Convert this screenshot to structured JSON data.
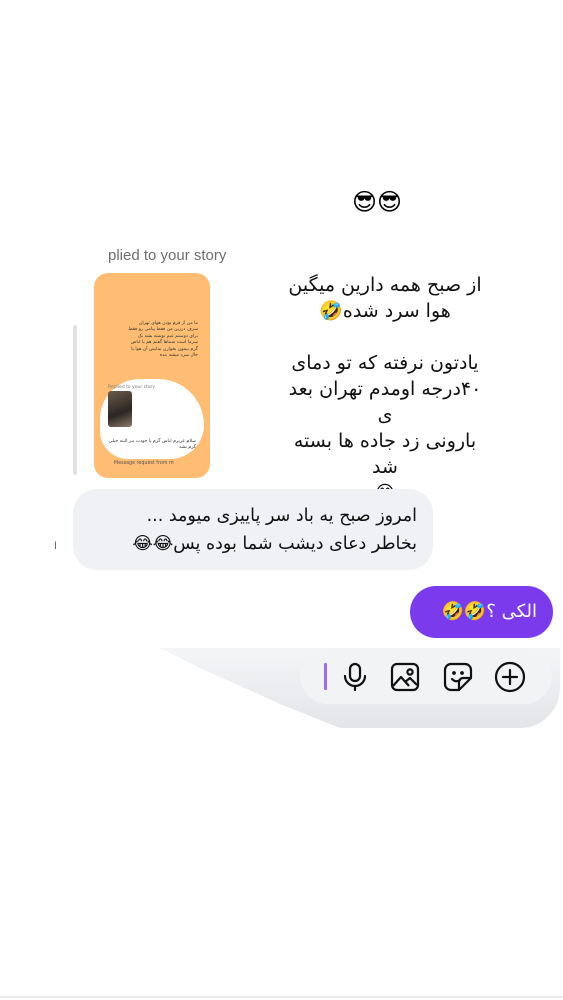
{
  "messages": {
    "reaction_emoji": "😎😎",
    "story_reply": {
      "label": "plied to your story",
      "caption_lines": [
        "از صبح همه دارین میگین",
        "هوا سرد شده🤣",
        "یادتون نرفته که تو دمای",
        "۴۰درجه اومدم تهران بعد ی",
        "بارونی زد جاده ها بسته شد",
        "😂"
      ],
      "thumbnail": {
        "story_text": "ما من از قرم بودن هوای تهران سرف درزین من فقط پیامی رو فقط برای دوستم عیم نوشته بشه یک سرما است شماها گفتم هم یا لباس گرم بیمون بخوارن نمایش آن هوا با حال سرد میشه بنده",
        "mini_label": "Replied to your story",
        "reply_text": "سلام عزیزم لباس گرم با خودت ببر البته خیلی گرم نشه",
        "request_text": "Message request from m"
      }
    },
    "incoming_text_line1": "امروز صبح یه باد سر پاییزی میومد ...",
    "incoming_text_line2": "بخاطر دعای دیشب شما بوده پس😂😂",
    "seen_marker": "ا",
    "outgoing_text": "الکی ؟🤣🤣"
  },
  "composer": {
    "icons": [
      "microphone-icon",
      "image-icon",
      "sticker-icon",
      "add-icon"
    ],
    "accent_color": "#7c3aed",
    "cursor_color": "#a06cf0"
  }
}
